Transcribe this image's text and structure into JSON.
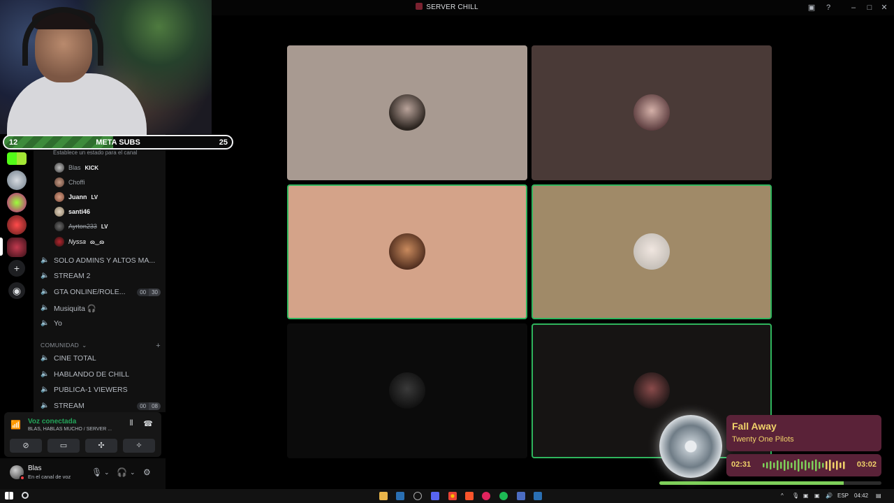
{
  "window": {
    "title": "SERVER CHILL"
  },
  "meta_bar": {
    "current": "12",
    "label": "META SUBS",
    "goal": "25",
    "progress": 0.48
  },
  "sidebar": {
    "status_hint": "Establece un estado para el canal",
    "members": [
      {
        "name": "Blas",
        "badge": "KICK"
      },
      {
        "name": "Choffi",
        "badge": ""
      },
      {
        "name": "Juann",
        "badge": "LV"
      },
      {
        "name": "santi46",
        "badge": ""
      },
      {
        "name": "Ayrton233",
        "badge": "LV"
      },
      {
        "name": "Nyssa",
        "badge": "ɷ‿ɷ"
      }
    ],
    "channels": [
      {
        "name": "SOLO ADMINS Y ALTOS MA..."
      },
      {
        "name": "STREAM 2"
      },
      {
        "name": "GTA ONLINE/ROLE...",
        "count_a": "00",
        "count_b": "30"
      },
      {
        "name": "Musiquita 🎧"
      },
      {
        "name": "Yo"
      }
    ],
    "category": "COMUNIDAD",
    "community_channels": [
      {
        "name": "CINE TOTAL"
      },
      {
        "name": "HABLANDO DE CHILL"
      },
      {
        "name": "PUBLICA-1 VIEWERS"
      },
      {
        "name": "STREAM",
        "count_a": "00",
        "count_b": "08"
      }
    ]
  },
  "voice_panel": {
    "title": "Voz conectada",
    "subtitle": "BLAS, HABLAS MUCHO / SERVER ..."
  },
  "user_panel": {
    "name": "Blas",
    "status": "En el canal de voz"
  },
  "now_playing": {
    "title": "Fall Away",
    "artist": "Twenty One Pilots",
    "elapsed": "02:31",
    "total": "03:02",
    "progress": 0.83
  },
  "taskbar": {
    "language": "ESP",
    "clock": "04:42"
  },
  "colors": {
    "speaking": "#2fb55d",
    "tile1": "#a89a91",
    "tile2": "#4a3a37",
    "tile3": "#d4a389",
    "tile4": "#a08a68",
    "tile5": "#0b0b0b",
    "tile6": "#161413",
    "np_card": "#5a2238",
    "np_text": "#f1d36a"
  }
}
